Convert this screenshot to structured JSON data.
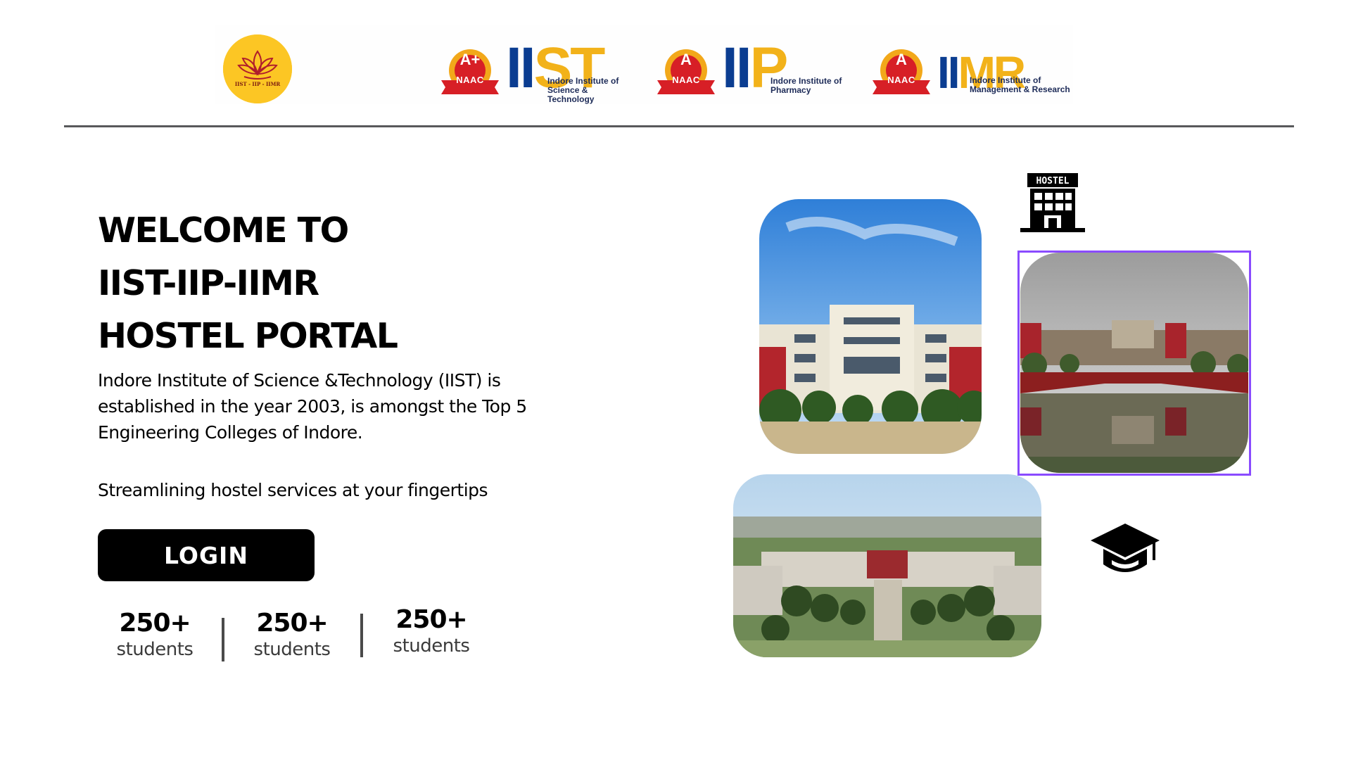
{
  "header": {
    "seal": {
      "top_text": "",
      "bottom_text": "IIST - IIP - IIMR"
    },
    "logos": [
      {
        "grade": "A+",
        "accreditation": "NAAC",
        "letters_blue": "II",
        "letters_yellow": "ST",
        "name_line1": "Indore Institute of",
        "name_line2": "Science & Technology"
      },
      {
        "grade": "A",
        "accreditation": "NAAC",
        "letters_blue": "II",
        "letters_yellow": "P",
        "name_line1": "Indore Institute of",
        "name_line2": "Pharmacy"
      },
      {
        "grade": "A",
        "accreditation": "NAAC",
        "letters_blue": "II",
        "letters_yellow": "MR",
        "name_line1": "Indore Institute of",
        "name_line2": "Management & Research"
      }
    ]
  },
  "hero": {
    "title_line1": "WELCOME TO",
    "title_line2": "IIST-IIP-IIMR",
    "title_line3": "HOSTEL PORTAL",
    "description": "Indore Institute of Science &Technology (IIST) is established in the year 2003, is amongst the Top 5 Engineering Colleges of Indore.",
    "tagline": "Streamlining hostel services at your fingertips",
    "login_label": "LOGIN"
  },
  "stats": [
    {
      "value": "250+",
      "label": "students"
    },
    {
      "value": "250+",
      "label": "students"
    },
    {
      "value": "250+",
      "label": "students"
    }
  ],
  "icons": {
    "hostel_sign": "HOSTEL",
    "hostel": "hostel-building-icon",
    "cap": "graduation-cap-icon"
  },
  "colors": {
    "seal_yellow": "#fcc624",
    "logo_blue": "#0b3d91",
    "logo_yellow": "#f2b21a",
    "badge_red": "#d71f26",
    "photo_highlight": "#8a4bff",
    "button": "#000000"
  }
}
